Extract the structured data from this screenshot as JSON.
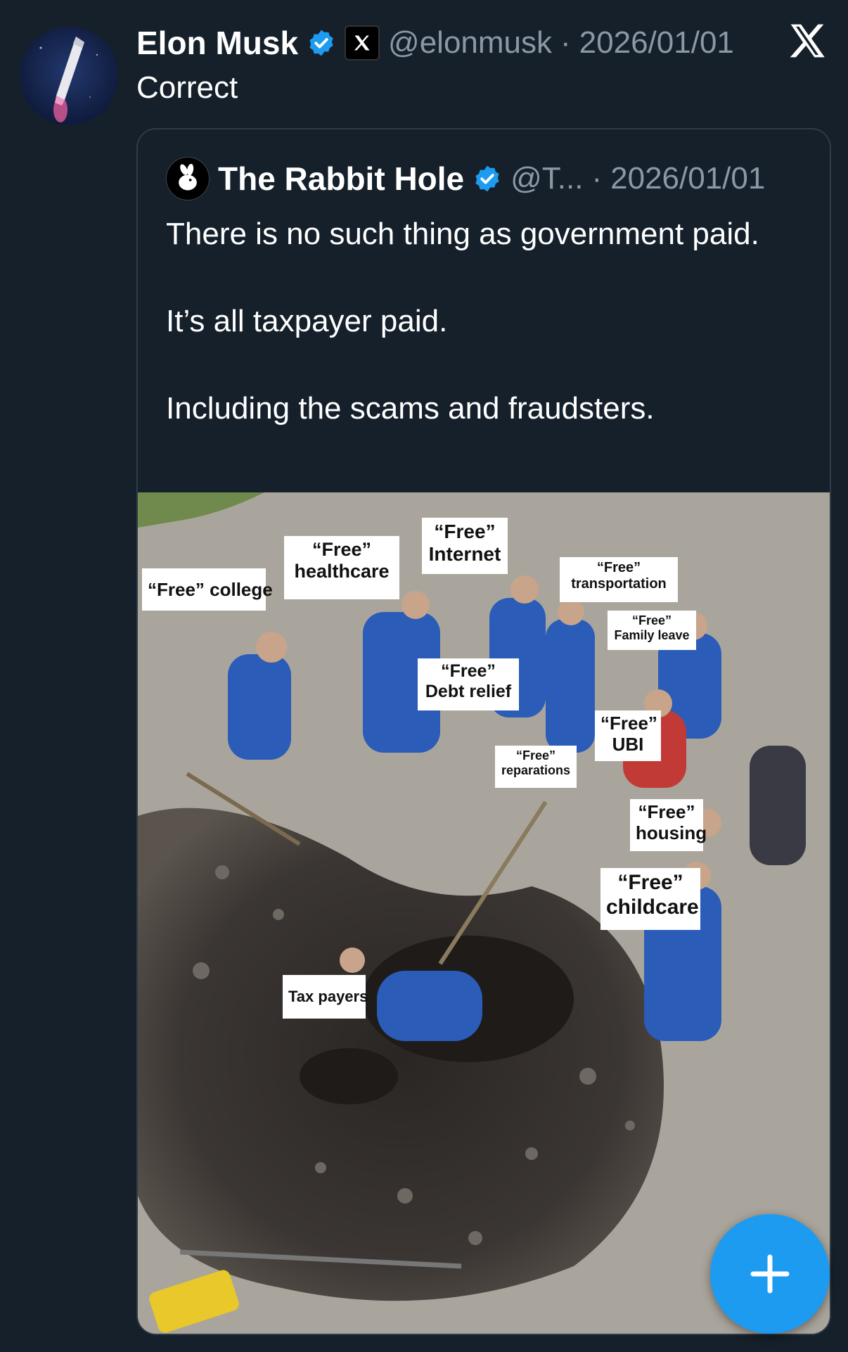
{
  "post": {
    "author_name": "Elon Musk",
    "handle": "@elonmusk",
    "separator": "·",
    "date": "2026/01/01",
    "text": "Correct"
  },
  "quoted_post": {
    "author_name": "The Rabbit Hole",
    "handle": "@T...",
    "separator": "·",
    "date": "2026/01/01",
    "paragraphs": [
      "There is no such thing as government paid.",
      "It’s all taxpayer paid.",
      "Including the scams and fraudsters."
    ]
  },
  "meme_labels": {
    "college": "“Free” college",
    "healthcare": "“Free”\nhealthcare",
    "internet": "“Free”\nInternet",
    "transportation": "“Free”\ntransportation",
    "family_leave": "“Free”\nFamily leave",
    "debt_relief": "“Free”\nDebt relief",
    "ubi": "“Free”\nUBI",
    "reparations": "“Free”\nreparations",
    "housing": "“Free”\nhousing",
    "childcare": "“Free”\nchildcare",
    "tax_payers": "Tax payers"
  },
  "icons": {
    "verified": "verified-badge-icon",
    "x_affiliate": "x-affiliate-icon",
    "x_logo": "x-logo-icon",
    "compose": "plus-icon"
  },
  "colors": {
    "background": "#15202b",
    "accent": "#1d9bf0",
    "secondary_text": "#8b98a5"
  }
}
